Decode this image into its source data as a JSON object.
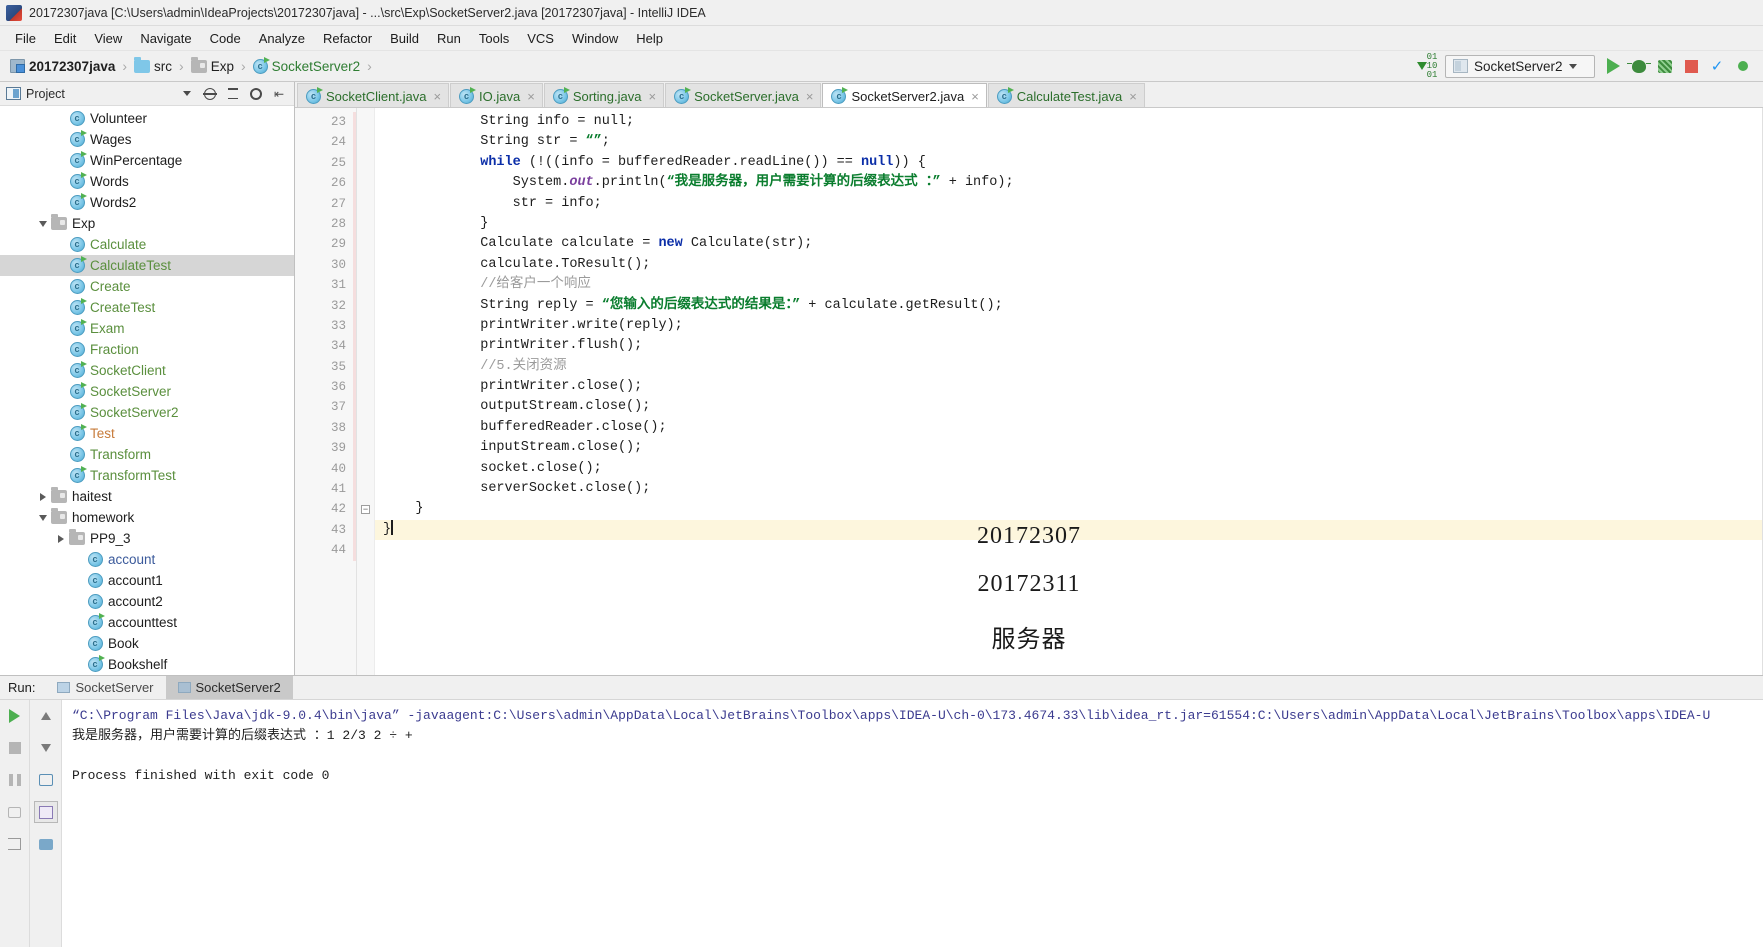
{
  "window": {
    "title": "20172307java [C:\\Users\\admin\\IdeaProjects\\20172307java] - ...\\src\\Exp\\SocketServer2.java [20172307java] - IntelliJ IDEA",
    "app_icon": "intellij-idea-icon"
  },
  "menu": {
    "items": [
      {
        "label": "File"
      },
      {
        "label": "Edit"
      },
      {
        "label": "View"
      },
      {
        "label": "Navigate"
      },
      {
        "label": "Code"
      },
      {
        "label": "Analyze"
      },
      {
        "label": "Refactor"
      },
      {
        "label": "Build"
      },
      {
        "label": "Run"
      },
      {
        "label": "Tools"
      },
      {
        "label": "VCS"
      },
      {
        "label": "Window"
      },
      {
        "label": "Help"
      }
    ]
  },
  "toolbar": {
    "breadcrumbs": [
      {
        "label": "20172307java",
        "icon": "module-icon",
        "style": "bold"
      },
      {
        "label": "src",
        "icon": "folder-icon",
        "style": "normal"
      },
      {
        "label": "Exp",
        "icon": "package-folder-icon",
        "style": "normal"
      },
      {
        "label": "SocketServer2",
        "icon": "java-class-icon",
        "style": "green"
      }
    ],
    "separator": "›",
    "run_config": {
      "label": "SocketServer2",
      "icon": "run-config-icon",
      "chevron": "chevron-down-icon"
    },
    "buttons": [
      {
        "name": "compile-icon",
        "label": "01\n10\n01"
      },
      {
        "name": "run-button",
        "label": "Run"
      },
      {
        "name": "debug-button",
        "label": "Debug"
      },
      {
        "name": "run-coverage-button",
        "label": "Run with Coverage"
      },
      {
        "name": "stop-button",
        "label": "Stop"
      },
      {
        "name": "vcs-update-button",
        "label": "Update Project"
      },
      {
        "name": "vcs-commit-button",
        "label": "Commit"
      }
    ]
  },
  "project_panel": {
    "title": "Project",
    "header_icons": [
      "project-view-icon",
      "chevron-down-icon",
      "locate-icon",
      "collapse-all-icon",
      "gear-icon",
      "hide-icon"
    ],
    "tree": [
      {
        "label": "Volunteer",
        "icon": "java-class-icon",
        "depth": 3,
        "color": "dark",
        "runnable": false,
        "expander": ""
      },
      {
        "label": "Wages",
        "icon": "java-class-icon",
        "depth": 3,
        "color": "dark",
        "runnable": true,
        "expander": ""
      },
      {
        "label": "WinPercentage",
        "icon": "java-class-icon",
        "depth": 3,
        "color": "dark",
        "runnable": true,
        "expander": ""
      },
      {
        "label": "Words",
        "icon": "java-class-icon",
        "depth": 3,
        "color": "dark",
        "runnable": true,
        "expander": ""
      },
      {
        "label": "Words2",
        "icon": "java-class-icon",
        "depth": 3,
        "color": "dark",
        "runnable": true,
        "expander": ""
      },
      {
        "label": "Exp",
        "icon": "package-folder-icon",
        "depth": 2,
        "color": "dark",
        "runnable": false,
        "expander": "down"
      },
      {
        "label": "Calculate",
        "icon": "java-class-icon",
        "depth": 3,
        "color": "green",
        "runnable": false,
        "expander": ""
      },
      {
        "label": "CalculateTest",
        "icon": "java-class-icon",
        "depth": 3,
        "color": "green",
        "runnable": true,
        "expander": "",
        "selected": true
      },
      {
        "label": "Create",
        "icon": "java-class-icon",
        "depth": 3,
        "color": "green",
        "runnable": false,
        "expander": ""
      },
      {
        "label": "CreateTest",
        "icon": "java-class-icon",
        "depth": 3,
        "color": "green",
        "runnable": true,
        "expander": ""
      },
      {
        "label": "Exam",
        "icon": "java-class-icon",
        "depth": 3,
        "color": "green",
        "runnable": true,
        "expander": ""
      },
      {
        "label": "Fraction",
        "icon": "java-class-icon",
        "depth": 3,
        "color": "green",
        "runnable": false,
        "expander": ""
      },
      {
        "label": "SocketClient",
        "icon": "java-class-icon",
        "depth": 3,
        "color": "green",
        "runnable": true,
        "expander": ""
      },
      {
        "label": "SocketServer",
        "icon": "java-class-icon",
        "depth": 3,
        "color": "green",
        "runnable": true,
        "expander": ""
      },
      {
        "label": "SocketServer2",
        "icon": "java-class-icon",
        "depth": 3,
        "color": "green",
        "runnable": true,
        "expander": ""
      },
      {
        "label": "Test",
        "icon": "java-class-icon",
        "depth": 3,
        "color": "orange",
        "runnable": true,
        "expander": ""
      },
      {
        "label": "Transform",
        "icon": "java-class-icon",
        "depth": 3,
        "color": "green",
        "runnable": false,
        "expander": ""
      },
      {
        "label": "TransformTest",
        "icon": "java-class-icon",
        "depth": 3,
        "color": "green",
        "runnable": true,
        "expander": ""
      },
      {
        "label": "haitest",
        "icon": "package-folder-icon",
        "depth": 2,
        "color": "dark",
        "runnable": false,
        "expander": "right"
      },
      {
        "label": "homework",
        "icon": "package-folder-icon",
        "depth": 2,
        "color": "dark",
        "runnable": false,
        "expander": "down"
      },
      {
        "label": "PP9_3",
        "icon": "package-folder-icon",
        "depth": 3,
        "color": "dark",
        "runnable": false,
        "expander": "right"
      },
      {
        "label": "account",
        "icon": "java-class-icon",
        "depth": 4,
        "color": "blue",
        "runnable": false,
        "expander": ""
      },
      {
        "label": "account1",
        "icon": "java-class-icon",
        "depth": 4,
        "color": "dark",
        "runnable": false,
        "expander": ""
      },
      {
        "label": "account2",
        "icon": "java-class-icon",
        "depth": 4,
        "color": "dark",
        "runnable": false,
        "expander": ""
      },
      {
        "label": "accounttest",
        "icon": "java-class-icon",
        "depth": 4,
        "color": "dark",
        "runnable": true,
        "expander": ""
      },
      {
        "label": "Book",
        "icon": "java-class-icon",
        "depth": 4,
        "color": "dark",
        "runnable": false,
        "expander": ""
      },
      {
        "label": "Bookshelf",
        "icon": "java-class-icon",
        "depth": 4,
        "color": "dark",
        "runnable": true,
        "expander": ""
      }
    ]
  },
  "editor": {
    "tabs": [
      {
        "label": "SocketClient.java",
        "active": false
      },
      {
        "label": "IO.java",
        "active": false
      },
      {
        "label": "Sorting.java",
        "active": false
      },
      {
        "label": "SocketServer.java",
        "active": false
      },
      {
        "label": "SocketServer2.java",
        "active": true
      },
      {
        "label": "CalculateTest.java",
        "active": false
      }
    ],
    "close_glyph": "×",
    "first_line_number": 23,
    "lines": [
      {
        "n": 23,
        "segments": [
          {
            "t": "            String info = null;",
            "c": "pl"
          }
        ],
        "clipped_top": true
      },
      {
        "n": 24,
        "segments": [
          {
            "t": "            String str = ",
            "c": "pl"
          },
          {
            "t": "“”",
            "c": "s"
          },
          {
            "t": ";",
            "c": "pl"
          }
        ]
      },
      {
        "n": 25,
        "segments": [
          {
            "t": "            ",
            "c": "pl"
          },
          {
            "t": "while",
            "c": "k"
          },
          {
            "t": " (!((info = bufferedReader.readLine()) == ",
            "c": "pl"
          },
          {
            "t": "null",
            "c": "k"
          },
          {
            "t": ")) {",
            "c": "pl"
          }
        ]
      },
      {
        "n": 26,
        "segments": [
          {
            "t": "                System.",
            "c": "pl"
          },
          {
            "t": "out",
            "c": "fld"
          },
          {
            "t": ".println(",
            "c": "pl"
          },
          {
            "t": "“我是服务器，用户需要计算的后缀表达式 ：”",
            "c": "s"
          },
          {
            "t": " + info);",
            "c": "pl"
          }
        ]
      },
      {
        "n": 27,
        "segments": [
          {
            "t": "                str = info;",
            "c": "pl"
          }
        ]
      },
      {
        "n": 28,
        "segments": [
          {
            "t": "            }",
            "c": "pl"
          }
        ]
      },
      {
        "n": 29,
        "segments": [
          {
            "t": "            Calculate calculate = ",
            "c": "pl"
          },
          {
            "t": "new",
            "c": "k"
          },
          {
            "t": " Calculate(str);",
            "c": "pl"
          }
        ]
      },
      {
        "n": 30,
        "segments": [
          {
            "t": "            calculate.ToResult();",
            "c": "pl"
          }
        ]
      },
      {
        "n": 31,
        "segments": [
          {
            "t": "            //给客户一个响应",
            "c": "cm"
          }
        ]
      },
      {
        "n": 32,
        "segments": [
          {
            "t": "            String reply = ",
            "c": "pl"
          },
          {
            "t": "“您输入的后缀表达式的结果是：”",
            "c": "s"
          },
          {
            "t": " + calculate.getResult();",
            "c": "pl"
          }
        ]
      },
      {
        "n": 33,
        "segments": [
          {
            "t": "            printWriter.write(reply);",
            "c": "pl"
          }
        ]
      },
      {
        "n": 34,
        "segments": [
          {
            "t": "            printWriter.flush();",
            "c": "pl"
          }
        ]
      },
      {
        "n": 35,
        "segments": [
          {
            "t": "            //5.关闭资源",
            "c": "cm"
          }
        ]
      },
      {
        "n": 36,
        "segments": [
          {
            "t": "            printWriter.close();",
            "c": "pl"
          }
        ]
      },
      {
        "n": 37,
        "segments": [
          {
            "t": "            outputStream.close();",
            "c": "pl"
          }
        ]
      },
      {
        "n": 38,
        "segments": [
          {
            "t": "            bufferedReader.close();",
            "c": "pl"
          }
        ]
      },
      {
        "n": 39,
        "segments": [
          {
            "t": "            inputStream.close();",
            "c": "pl"
          }
        ]
      },
      {
        "n": 40,
        "segments": [
          {
            "t": "            socket.close();",
            "c": "pl"
          }
        ]
      },
      {
        "n": 41,
        "segments": [
          {
            "t": "            serverSocket.close();",
            "c": "pl"
          }
        ]
      },
      {
        "n": 42,
        "segments": [
          {
            "t": "    }",
            "c": "pl"
          }
        ],
        "fold": true
      },
      {
        "n": 43,
        "segments": [
          {
            "t": "}",
            "c": "pl"
          }
        ],
        "highlight": true,
        "caret": true
      },
      {
        "n": 44,
        "segments": [
          {
            "t": "",
            "c": "pl"
          }
        ]
      }
    ],
    "overlay_lines": [
      "20172307",
      "20172311",
      "服务器"
    ]
  },
  "run_panel": {
    "label": "Run:",
    "tabs": [
      {
        "label": "SocketServer",
        "active": false
      },
      {
        "label": "SocketServer2",
        "active": true
      }
    ],
    "left_buttons": [
      {
        "name": "rerun-button",
        "label": "Rerun"
      },
      {
        "name": "stop-button",
        "label": "Stop"
      },
      {
        "name": "pause-output-button",
        "label": "Pause Output"
      },
      {
        "name": "dump-threads-button",
        "label": "Dump Threads"
      },
      {
        "name": "exit-button",
        "label": "Close"
      }
    ],
    "right_buttons": [
      {
        "name": "scroll-up-button",
        "label": "Up the Stack Trace"
      },
      {
        "name": "scroll-down-button",
        "label": "Down the Stack Trace"
      },
      {
        "name": "soft-wrap-button",
        "label": "Soft-Wrap"
      },
      {
        "name": "scroll-to-end-button",
        "label": "Scroll to End"
      },
      {
        "name": "export-button",
        "label": "Export to Text File"
      },
      {
        "name": "print-button",
        "label": "Print"
      }
    ],
    "console_lines": [
      {
        "text": "“C:\\Program Files\\Java\\jdk-9.0.4\\bin\\java” -javaagent:C:\\Users\\admin\\AppData\\Local\\JetBrains\\Toolbox\\apps\\IDEA-U\\ch-0\\173.4674.33\\lib\\idea_rt.jar=61554:C:\\Users\\admin\\AppData\\Local\\JetBrains\\Toolbox\\apps\\IDEA-U",
        "class": "cmdline"
      },
      {
        "text": "我是服务器，用户需要计算的后缀表达式 ：1 2/3 2 ÷ +",
        "class": "plain"
      },
      {
        "text": "",
        "class": "plain"
      },
      {
        "text": "Process finished with exit code 0",
        "class": "plain"
      }
    ]
  },
  "colors": {
    "accent_green": "#4caf50",
    "keyword_blue": "#0b2ea8",
    "string_green": "#0a7d2e",
    "comment_gray": "#9b9b9b",
    "selection_gray": "#d6d6d6",
    "highlight_yellow": "#fdf6dd"
  }
}
